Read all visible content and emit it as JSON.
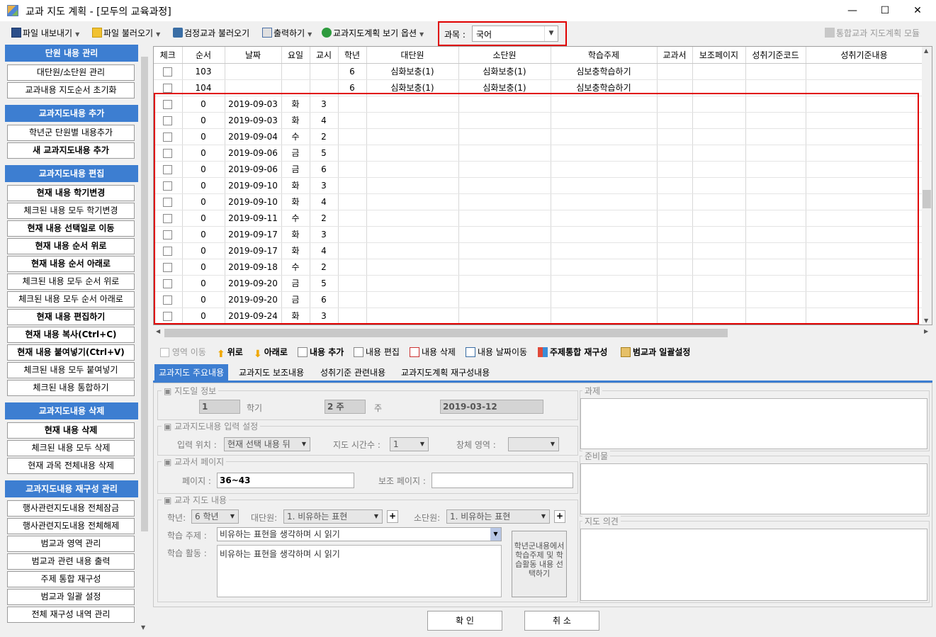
{
  "window": {
    "title": "교과 지도 계획 - [모두의 교육과정]",
    "minimize": "—",
    "maximize": "☐",
    "close": "✕"
  },
  "toolbar": {
    "export_label": "파일 내보내기",
    "import_label": "파일 불러오기",
    "textbook_load_label": "검정교과 불러오기",
    "print_label": "출력하기",
    "view_options_label": "교과지도계획 보기 옵션",
    "subject_label": "과목 :",
    "subject_value": "국어",
    "integrated_label": "통합교과 지도계획 모듈"
  },
  "sidebar": {
    "sections": [
      {
        "title": "단원 내용 관리",
        "items": [
          {
            "label": "대단원/소단원 관리",
            "bold": false
          },
          {
            "label": "교과내용 지도순서 초기화",
            "bold": false
          }
        ]
      },
      {
        "title": "교과지도내용 추가",
        "items": [
          {
            "label": "학년군 단원별 내용추가",
            "bold": false
          },
          {
            "label": "새 교과지도내용 추가",
            "bold": true
          }
        ]
      },
      {
        "title": "교과지도내용 편집",
        "items": [
          {
            "label": "현재 내용 학기변경",
            "bold": true
          },
          {
            "label": "체크된 내용 모두 학기변경",
            "bold": false
          },
          {
            "label": "현재 내용 선택일로 이동",
            "bold": true
          },
          {
            "label": "현재 내용 순서 위로",
            "bold": true
          },
          {
            "label": "현재 내용 순서 아래로",
            "bold": true
          },
          {
            "label": "체크된 내용 모두 순서 위로",
            "bold": false
          },
          {
            "label": "체크된 내용 모두 순서 아래로",
            "bold": false
          },
          {
            "label": "현재 내용 편집하기",
            "bold": true
          },
          {
            "label": "현재 내용 복사(Ctrl+C)",
            "bold": true
          },
          {
            "label": "현재 내용 붙여넣기(Ctrl+V)",
            "bold": true
          },
          {
            "label": "체크된 내용 모두 붙여넣기",
            "bold": false
          },
          {
            "label": "체크된 내용 통합하기",
            "bold": false
          }
        ]
      },
      {
        "title": "교과지도내용 삭제",
        "items": [
          {
            "label": "현재 내용 삭제",
            "bold": true
          },
          {
            "label": "체크된 내용 모두 삭제",
            "bold": false
          },
          {
            "label": "현재 과목 전체내용 삭제",
            "bold": false
          }
        ]
      },
      {
        "title": "교과지도내용 재구성 관리",
        "items": [
          {
            "label": "행사관련지도내용 전체잠금",
            "bold": false
          },
          {
            "label": "행사관련지도내용 전체해제",
            "bold": false
          },
          {
            "label": "범교과 영역 관리",
            "bold": false
          },
          {
            "label": "범교과 관련 내용 출력",
            "bold": false
          },
          {
            "label": "주제 통합 재구성",
            "bold": false
          },
          {
            "label": "범교과 일괄 설정",
            "bold": false
          },
          {
            "label": "전체 재구성 내역 관리",
            "bold": false
          }
        ]
      }
    ]
  },
  "grid": {
    "columns": [
      "체크",
      "순서",
      "날짜",
      "요일",
      "교시",
      "학년",
      "대단원",
      "소단원",
      "학습주제",
      "교과서",
      "보조페이지",
      "성취기준코드",
      "성취기준내용"
    ],
    "rows": [
      [
        "",
        "103",
        "",
        "",
        "",
        "6",
        "심화보충(1)",
        "심화보충(1)",
        "심보충학습하기",
        "",
        "",
        "",
        ""
      ],
      [
        "",
        "104",
        "",
        "",
        "",
        "6",
        "심화보충(1)",
        "심화보충(1)",
        "심보충학습하기",
        "",
        "",
        "",
        ""
      ],
      [
        "",
        "0",
        "2019-09-03",
        "화",
        "3",
        "",
        "",
        "",
        "",
        "",
        "",
        "",
        ""
      ],
      [
        "",
        "0",
        "2019-09-03",
        "화",
        "4",
        "",
        "",
        "",
        "",
        "",
        "",
        "",
        ""
      ],
      [
        "",
        "0",
        "2019-09-04",
        "수",
        "2",
        "",
        "",
        "",
        "",
        "",
        "",
        "",
        ""
      ],
      [
        "",
        "0",
        "2019-09-06",
        "금",
        "5",
        "",
        "",
        "",
        "",
        "",
        "",
        "",
        ""
      ],
      [
        "",
        "0",
        "2019-09-06",
        "금",
        "6",
        "",
        "",
        "",
        "",
        "",
        "",
        "",
        ""
      ],
      [
        "",
        "0",
        "2019-09-10",
        "화",
        "3",
        "",
        "",
        "",
        "",
        "",
        "",
        "",
        ""
      ],
      [
        "",
        "0",
        "2019-09-10",
        "화",
        "4",
        "",
        "",
        "",
        "",
        "",
        "",
        "",
        ""
      ],
      [
        "",
        "0",
        "2019-09-11",
        "수",
        "2",
        "",
        "",
        "",
        "",
        "",
        "",
        "",
        ""
      ],
      [
        "",
        "0",
        "2019-09-17",
        "화",
        "3",
        "",
        "",
        "",
        "",
        "",
        "",
        "",
        ""
      ],
      [
        "",
        "0",
        "2019-09-17",
        "화",
        "4",
        "",
        "",
        "",
        "",
        "",
        "",
        "",
        ""
      ],
      [
        "",
        "0",
        "2019-09-18",
        "수",
        "2",
        "",
        "",
        "",
        "",
        "",
        "",
        "",
        ""
      ],
      [
        "",
        "0",
        "2019-09-20",
        "금",
        "5",
        "",
        "",
        "",
        "",
        "",
        "",
        "",
        ""
      ],
      [
        "",
        "0",
        "2019-09-20",
        "금",
        "6",
        "",
        "",
        "",
        "",
        "",
        "",
        "",
        ""
      ],
      [
        "",
        "0",
        "2019-09-24",
        "화",
        "3",
        "",
        "",
        "",
        "",
        "",
        "",
        "",
        ""
      ]
    ]
  },
  "actions": {
    "area_move": "영역 이동",
    "up": "위로",
    "down": "아래로",
    "add": "내용 추가",
    "edit": "내용 편집",
    "delete": "내용 삭제",
    "date_move": "내용 날짜이동",
    "theme_reconstruct": "주제통합 재구성",
    "cross_batch": "범교과 일괄설정"
  },
  "tabs": [
    "교과지도 주요내용",
    "교과지도 보조내용",
    "성취기준 관련내용",
    "교과지도계획 재구성내용"
  ],
  "panel": {
    "guide_day": {
      "title": "지도일 정보",
      "semester": "1",
      "semester_label": "학기",
      "week": "2 주",
      "week_label": "주",
      "date": "2019-03-12"
    },
    "input_settings": {
      "title": "교과지도내용 입력 설정",
      "position_label": "입력 위치 :",
      "position_value": "현재 선택 내용 뒤",
      "hours_label": "지도 시간수 :",
      "hours_value": "1",
      "area_label": "창체 영역 :",
      "area_value": ""
    },
    "textbook_page": {
      "title": "교과서 페이지",
      "page_label": "페이지 :",
      "page_value": "36~43",
      "aux_label": "보조 페이지 :",
      "aux_value": ""
    },
    "content": {
      "title": "교과 지도 내용",
      "grade_label": "학년:",
      "grade_value": "6 학년",
      "unit_label": "대단원:",
      "unit_value": "1. 비유하는 표현",
      "subunit_label": "소단원:",
      "subunit_value": "1. 비유하는 표현",
      "topic_label": "학습 주제 :",
      "topic_value": "비유하는 표현을 생각하며 시 읽기",
      "activity_label": "학습 활동 :",
      "activity_value": "비유하는 표현을 생각하며 시 읽기",
      "select_button": "학년군내용에서 학습주제 및 학습활동 내용 선택하기"
    },
    "side": {
      "task_title": "과제",
      "prep_title": "준비물",
      "opinion_title": "지도 의견"
    }
  },
  "footer": {
    "confirm": "확 인",
    "cancel": "취 소"
  },
  "colors": {
    "accent": "#3d7ed1",
    "highlight": "#e00000"
  }
}
